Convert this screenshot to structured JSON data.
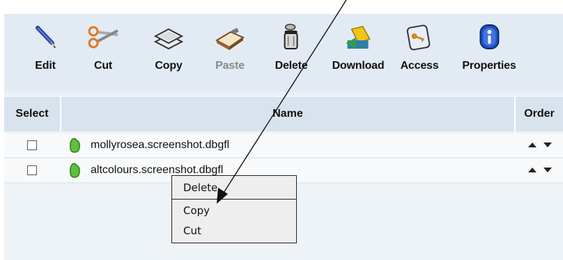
{
  "toolbar": {
    "edit_label": "Edit",
    "cut_label": "Cut",
    "copy_label": "Copy",
    "paste_label": "Paste",
    "delete_label": "Delete",
    "download_label": "Download",
    "access_label": "Access",
    "properties_label": "Properties"
  },
  "table": {
    "headers": {
      "select": "Select",
      "name": "Name",
      "order": "Order"
    },
    "rows": [
      {
        "name": "mollyrosea.screenshot.dbgfl"
      },
      {
        "name": "altcolours.screenshot.dbgfl"
      }
    ]
  },
  "context_menu": {
    "items": [
      "Delete",
      "Copy",
      "Cut"
    ]
  },
  "icons": {
    "edit": "pencil-icon",
    "cut": "scissors-icon",
    "copy": "stacked-layers-icon",
    "paste": "clipboard-icon",
    "delete": "trash-can-icon",
    "download": "download-icon",
    "access": "key-icon",
    "properties": "info-icon",
    "file": "file-icon"
  },
  "colors": {
    "toolbar_bg": "#e2ebf4",
    "header_bg": "#d9e3ee",
    "file_icon": "#5fbf3f",
    "disabled_text": "#8a8a8a"
  }
}
